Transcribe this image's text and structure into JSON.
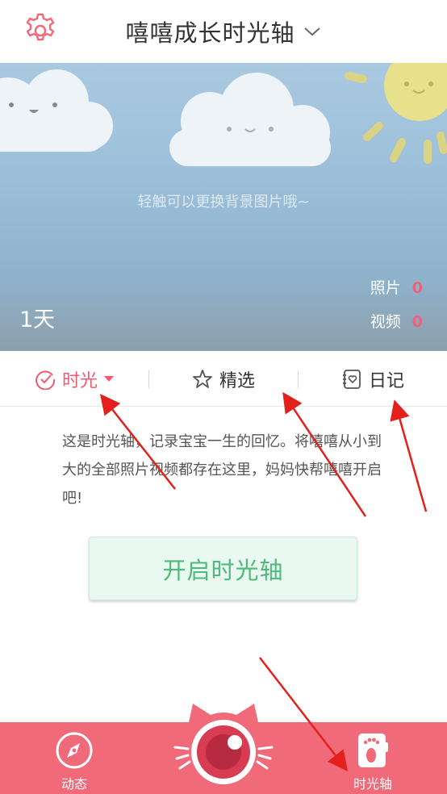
{
  "header": {
    "title": "嘻嘻成长时光轴"
  },
  "banner": {
    "hint": "轻触可以更换背景图片哦~",
    "days": "1天",
    "photos_label": "照片",
    "photos_count": "0",
    "videos_label": "视频",
    "videos_count": "0"
  },
  "tabs": [
    {
      "label": "时光",
      "active": true
    },
    {
      "label": "精选",
      "active": false
    },
    {
      "label": "日记",
      "active": false
    }
  ],
  "intro_text": "这是时光轴，记录宝宝一生的回忆。将嘻嘻从小到大的全部照片视频都存在这里，妈妈快帮嘻嘻开启吧!",
  "start_button": "开启时光轴",
  "bottom_nav": {
    "left_label": "动态",
    "right_label": "时光轴"
  },
  "colors": {
    "accent_pink": "#f06a79",
    "active_tab": "#f25a72",
    "button_green": "#4fba7a",
    "annotation_red": "#e3201b"
  },
  "icons": [
    "gear-icon",
    "chevron-down-icon",
    "clock-check-icon",
    "star-icon",
    "diary-icon",
    "compass-icon",
    "camera-cat-icon",
    "footprint-icon"
  ]
}
